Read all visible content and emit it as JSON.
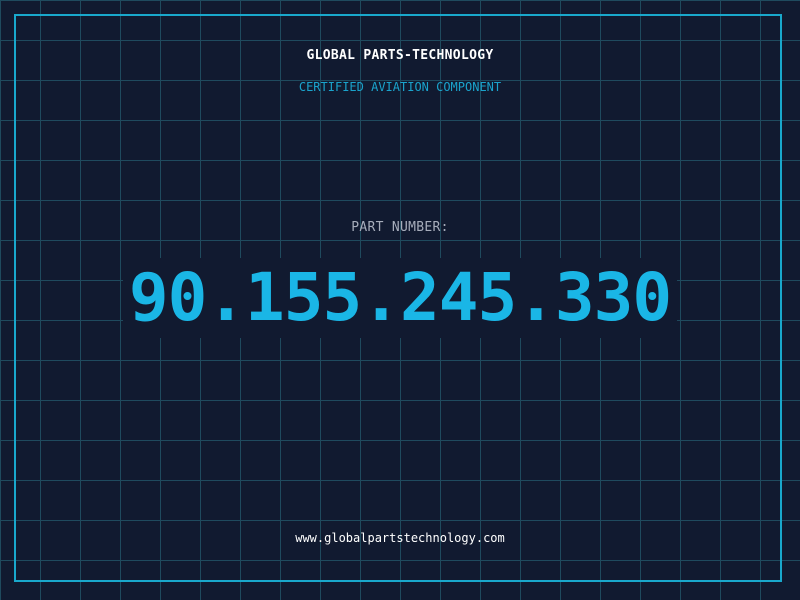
{
  "header": {
    "brand": "GLOBAL PARTS-TECHNOLOGY",
    "subtitle": "CERTIFIED AVIATION COMPONENT"
  },
  "part": {
    "label": "PART NUMBER:",
    "number": "90.155.245.330"
  },
  "footer": {
    "url": "www.globalpartstechnology.com"
  },
  "colors": {
    "background": "#111a30",
    "grid": "#1f4a5e",
    "frame": "#19a8cc",
    "accent": "#1ab6e6",
    "label": "#a7adbb",
    "text": "#ffffff"
  }
}
